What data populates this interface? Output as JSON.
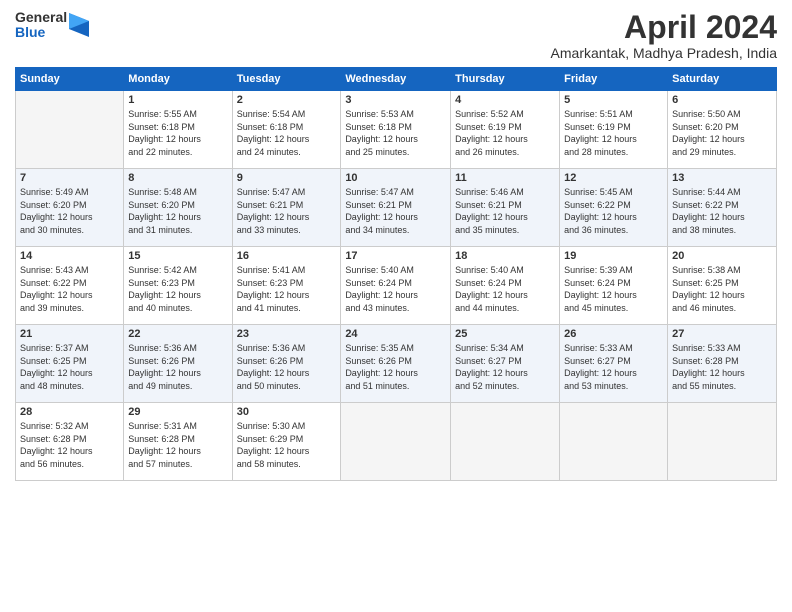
{
  "logo": {
    "general": "General",
    "blue": "Blue"
  },
  "title": "April 2024",
  "subtitle": "Amarkantak, Madhya Pradesh, India",
  "days_header": [
    "Sunday",
    "Monday",
    "Tuesday",
    "Wednesday",
    "Thursday",
    "Friday",
    "Saturday"
  ],
  "weeks": [
    [
      {
        "day": "",
        "empty": true
      },
      {
        "day": "1",
        "sunrise": "5:55 AM",
        "sunset": "6:18 PM",
        "daylight": "12 hours and 22 minutes."
      },
      {
        "day": "2",
        "sunrise": "5:54 AM",
        "sunset": "6:18 PM",
        "daylight": "12 hours and 24 minutes."
      },
      {
        "day": "3",
        "sunrise": "5:53 AM",
        "sunset": "6:18 PM",
        "daylight": "12 hours and 25 minutes."
      },
      {
        "day": "4",
        "sunrise": "5:52 AM",
        "sunset": "6:19 PM",
        "daylight": "12 hours and 26 minutes."
      },
      {
        "day": "5",
        "sunrise": "5:51 AM",
        "sunset": "6:19 PM",
        "daylight": "12 hours and 28 minutes."
      },
      {
        "day": "6",
        "sunrise": "5:50 AM",
        "sunset": "6:20 PM",
        "daylight": "12 hours and 29 minutes."
      }
    ],
    [
      {
        "day": "7",
        "sunrise": "5:49 AM",
        "sunset": "6:20 PM",
        "daylight": "12 hours and 30 minutes."
      },
      {
        "day": "8",
        "sunrise": "5:48 AM",
        "sunset": "6:20 PM",
        "daylight": "12 hours and 31 minutes."
      },
      {
        "day": "9",
        "sunrise": "5:47 AM",
        "sunset": "6:21 PM",
        "daylight": "12 hours and 33 minutes."
      },
      {
        "day": "10",
        "sunrise": "5:47 AM",
        "sunset": "6:21 PM",
        "daylight": "12 hours and 34 minutes."
      },
      {
        "day": "11",
        "sunrise": "5:46 AM",
        "sunset": "6:21 PM",
        "daylight": "12 hours and 35 minutes."
      },
      {
        "day": "12",
        "sunrise": "5:45 AM",
        "sunset": "6:22 PM",
        "daylight": "12 hours and 36 minutes."
      },
      {
        "day": "13",
        "sunrise": "5:44 AM",
        "sunset": "6:22 PM",
        "daylight": "12 hours and 38 minutes."
      }
    ],
    [
      {
        "day": "14",
        "sunrise": "5:43 AM",
        "sunset": "6:22 PM",
        "daylight": "12 hours and 39 minutes."
      },
      {
        "day": "15",
        "sunrise": "5:42 AM",
        "sunset": "6:23 PM",
        "daylight": "12 hours and 40 minutes."
      },
      {
        "day": "16",
        "sunrise": "5:41 AM",
        "sunset": "6:23 PM",
        "daylight": "12 hours and 41 minutes."
      },
      {
        "day": "17",
        "sunrise": "5:40 AM",
        "sunset": "6:24 PM",
        "daylight": "12 hours and 43 minutes."
      },
      {
        "day": "18",
        "sunrise": "5:40 AM",
        "sunset": "6:24 PM",
        "daylight": "12 hours and 44 minutes."
      },
      {
        "day": "19",
        "sunrise": "5:39 AM",
        "sunset": "6:24 PM",
        "daylight": "12 hours and 45 minutes."
      },
      {
        "day": "20",
        "sunrise": "5:38 AM",
        "sunset": "6:25 PM",
        "daylight": "12 hours and 46 minutes."
      }
    ],
    [
      {
        "day": "21",
        "sunrise": "5:37 AM",
        "sunset": "6:25 PM",
        "daylight": "12 hours and 48 minutes."
      },
      {
        "day": "22",
        "sunrise": "5:36 AM",
        "sunset": "6:26 PM",
        "daylight": "12 hours and 49 minutes."
      },
      {
        "day": "23",
        "sunrise": "5:36 AM",
        "sunset": "6:26 PM",
        "daylight": "12 hours and 50 minutes."
      },
      {
        "day": "24",
        "sunrise": "5:35 AM",
        "sunset": "6:26 PM",
        "daylight": "12 hours and 51 minutes."
      },
      {
        "day": "25",
        "sunrise": "5:34 AM",
        "sunset": "6:27 PM",
        "daylight": "12 hours and 52 minutes."
      },
      {
        "day": "26",
        "sunrise": "5:33 AM",
        "sunset": "6:27 PM",
        "daylight": "12 hours and 53 minutes."
      },
      {
        "day": "27",
        "sunrise": "5:33 AM",
        "sunset": "6:28 PM",
        "daylight": "12 hours and 55 minutes."
      }
    ],
    [
      {
        "day": "28",
        "sunrise": "5:32 AM",
        "sunset": "6:28 PM",
        "daylight": "12 hours and 56 minutes."
      },
      {
        "day": "29",
        "sunrise": "5:31 AM",
        "sunset": "6:28 PM",
        "daylight": "12 hours and 57 minutes."
      },
      {
        "day": "30",
        "sunrise": "5:30 AM",
        "sunset": "6:29 PM",
        "daylight": "12 hours and 58 minutes."
      },
      {
        "day": "",
        "empty": true
      },
      {
        "day": "",
        "empty": true
      },
      {
        "day": "",
        "empty": true
      },
      {
        "day": "",
        "empty": true
      }
    ]
  ]
}
